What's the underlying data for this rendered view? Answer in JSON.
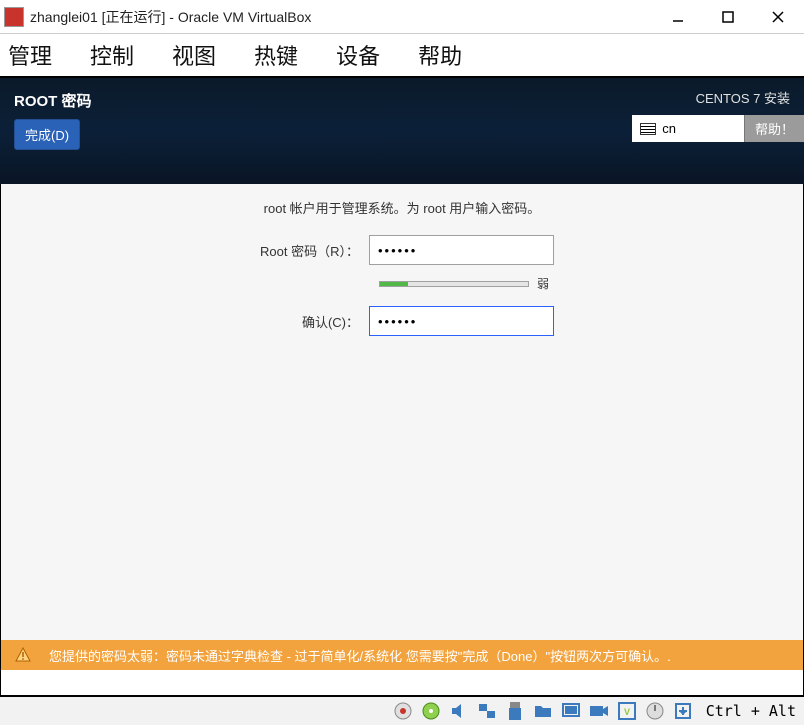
{
  "titlebar": {
    "title": "zhanglei01 [正在运行] - Oracle VM VirtualBox"
  },
  "menubar": {
    "items": [
      "管理",
      "控制",
      "视图",
      "热键",
      "设备",
      "帮助"
    ]
  },
  "header": {
    "root_title": "ROOT 密码",
    "done_button": "完成(D)",
    "centos_label": "CENTOS 7 安装",
    "lang": "cn",
    "help_button": "帮助！"
  },
  "form": {
    "instruction": "root 帐户用于管理系统。为 root 用户输入密码。",
    "password_label": "Root 密码（R）：",
    "password_value": "••••••",
    "strength_label": "弱",
    "confirm_label": "确认(C)：",
    "confirm_value": "••••••"
  },
  "warning": {
    "text": "您提供的密码太弱：密码未通过字典检查 - 过于简单化/系统化 您需要按\"完成（Done）\"按钮两次方可确认。."
  },
  "statusbar": {
    "hostkey": "Ctrl + Alt"
  }
}
